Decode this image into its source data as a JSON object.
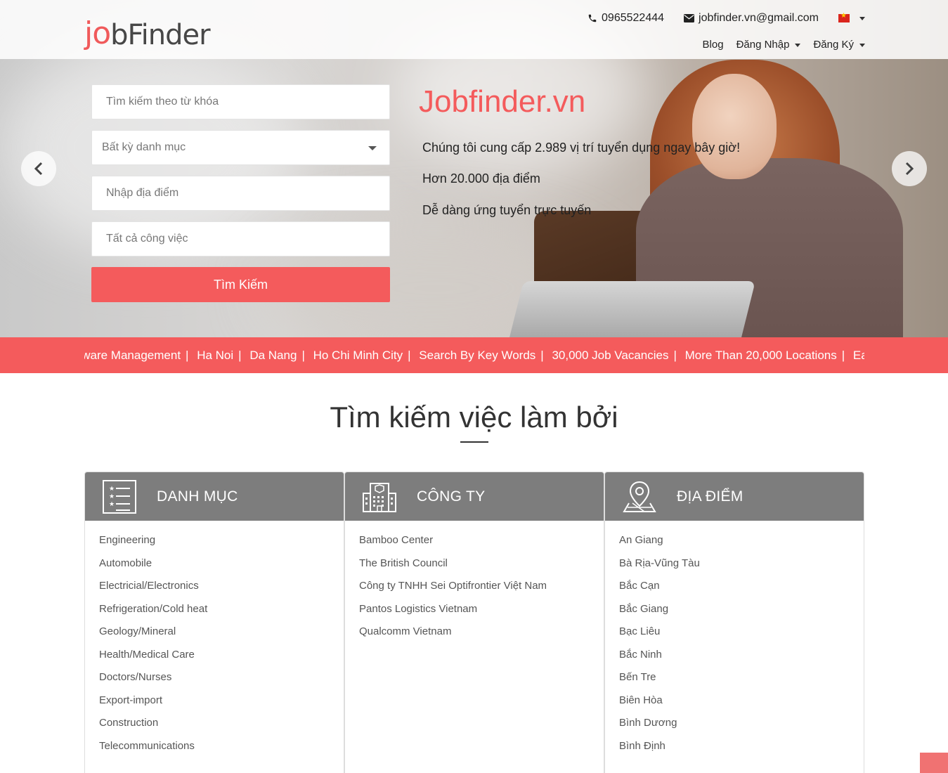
{
  "brand": {
    "logo_text_j": "j",
    "logo_text_o": "o",
    "logo_text_rest": "bFinder",
    "accent_color": "#f45b5c"
  },
  "header": {
    "phone": "0965522444",
    "email": "jobfinder.vn@gmail.com",
    "language_flag": "vietnam-flag-icon",
    "nav": {
      "blog": "Blog",
      "login": "Đăng Nhập",
      "register": "Đăng Ký"
    }
  },
  "search": {
    "keyword_placeholder": "Tìm kiếm theo từ khóa",
    "category_value": "Bất kỳ danh mục",
    "location_placeholder": "Nhập địa điểm",
    "job_placeholder": "Tất cả công việc",
    "button_label": "Tìm Kiếm"
  },
  "hero": {
    "title": "Jobfinder.vn",
    "lines": [
      "Chúng tôi cung cấp 2.989 vị trí tuyển dụng ngay bây giờ!",
      "Hơn 20.000 địa điểm",
      "Dễ dàng ứng tuyển trực tuyến"
    ]
  },
  "ticker": {
    "items": [
      "Software Management",
      "Ha Noi",
      "Da Nang",
      "Ho Chi Minh City",
      "Search By Key Words",
      "30,000 Job Vacancies",
      "More Than 20,000 Locations",
      "Easy To Apply"
    ],
    "separator": "|"
  },
  "section": {
    "title": "Tìm kiếm việc làm bởi"
  },
  "cards": {
    "category": {
      "title": "DANH MỤC",
      "icon": "list-icon",
      "items": [
        "Engineering",
        "Automobile",
        "Electricial/Electronics",
        "Refrigeration/Cold heat",
        "Geology/Mineral",
        "Health/Medical Care",
        "Doctors/Nurses",
        "Export-import",
        "Construction",
        "Telecommunications"
      ]
    },
    "company": {
      "title": "CÔNG TY",
      "icon": "building-icon",
      "items": [
        "Bamboo Center",
        "The British Council",
        "Công ty TNHH Sei Optifrontier Việt Nam",
        "Pantos Logistics Vietnam",
        "Qualcomm Vietnam"
      ]
    },
    "location": {
      "title": "ĐỊA ĐIỂM",
      "icon": "map-pin-icon",
      "items": [
        "An Giang",
        "Bà Rịa-Vũng Tàu",
        "Bắc Cạn",
        "Bắc Giang",
        "Bạc Liêu",
        "Bắc Ninh",
        "Bến Tre",
        "Biên Hòa",
        "Bình Dương",
        "Bình Định"
      ]
    }
  }
}
